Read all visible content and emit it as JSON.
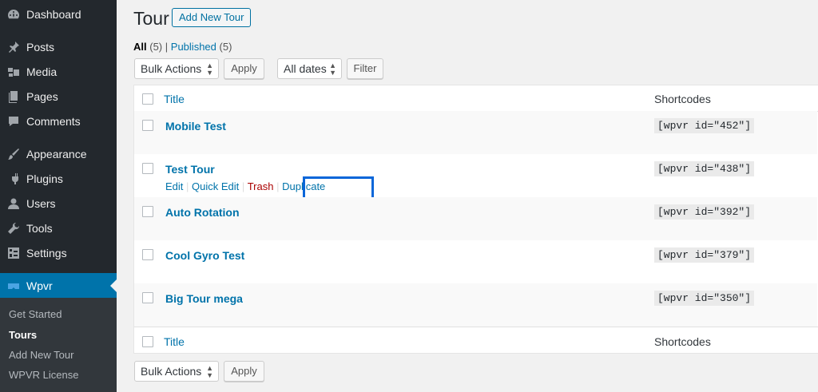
{
  "sidebar": {
    "items": [
      {
        "label": "Dashboard",
        "icon": "dashboard-icon"
      },
      {
        "label": "Posts",
        "icon": "pin-icon"
      },
      {
        "label": "Media",
        "icon": "media-icon"
      },
      {
        "label": "Pages",
        "icon": "pages-icon"
      },
      {
        "label": "Comments",
        "icon": "comments-icon"
      },
      {
        "label": "Appearance",
        "icon": "brush-icon"
      },
      {
        "label": "Plugins",
        "icon": "plugin-icon"
      },
      {
        "label": "Users",
        "icon": "users-icon"
      },
      {
        "label": "Tools",
        "icon": "wrench-icon"
      },
      {
        "label": "Settings",
        "icon": "settings-icon"
      },
      {
        "label": "Wpvr",
        "icon": "wpvr-icon"
      }
    ],
    "submenu": [
      "Get Started",
      "Tours",
      "Add New Tour",
      "WPVR License"
    ],
    "accent": "#0073aa"
  },
  "header": {
    "title": "Tour",
    "add_new": "Add New Tour"
  },
  "views": {
    "all": "All",
    "all_count": "(5)",
    "sep": "|",
    "published": "Published",
    "published_count": "(5)"
  },
  "toolbar": {
    "bulk_actions": "Bulk Actions",
    "apply": "Apply",
    "all_dates": "All dates",
    "filter": "Filter"
  },
  "table": {
    "columns": {
      "title": "Title",
      "shortcodes": "Shortcodes"
    },
    "rows": [
      {
        "title": "Mobile Test",
        "shortcode": "[wpvr id=\"452\"]"
      },
      {
        "title": "Test Tour",
        "shortcode": "[wpvr id=\"438\"]"
      },
      {
        "title": "Auto Rotation",
        "shortcode": "[wpvr id=\"392\"]"
      },
      {
        "title": "Cool Gyro Test",
        "shortcode": "[wpvr id=\"379\"]"
      },
      {
        "title": "Big Tour mega",
        "shortcode": "[wpvr id=\"350\"]"
      }
    ],
    "row_actions": {
      "edit": "Edit",
      "quick_edit": "Quick Edit",
      "trash": "Trash",
      "duplicate": "Duplicate",
      "sep": "|"
    },
    "highlight_color": "#0a66d9"
  },
  "bottom_toolbar": {
    "bulk_actions": "Bulk Actions",
    "apply": "Apply"
  }
}
